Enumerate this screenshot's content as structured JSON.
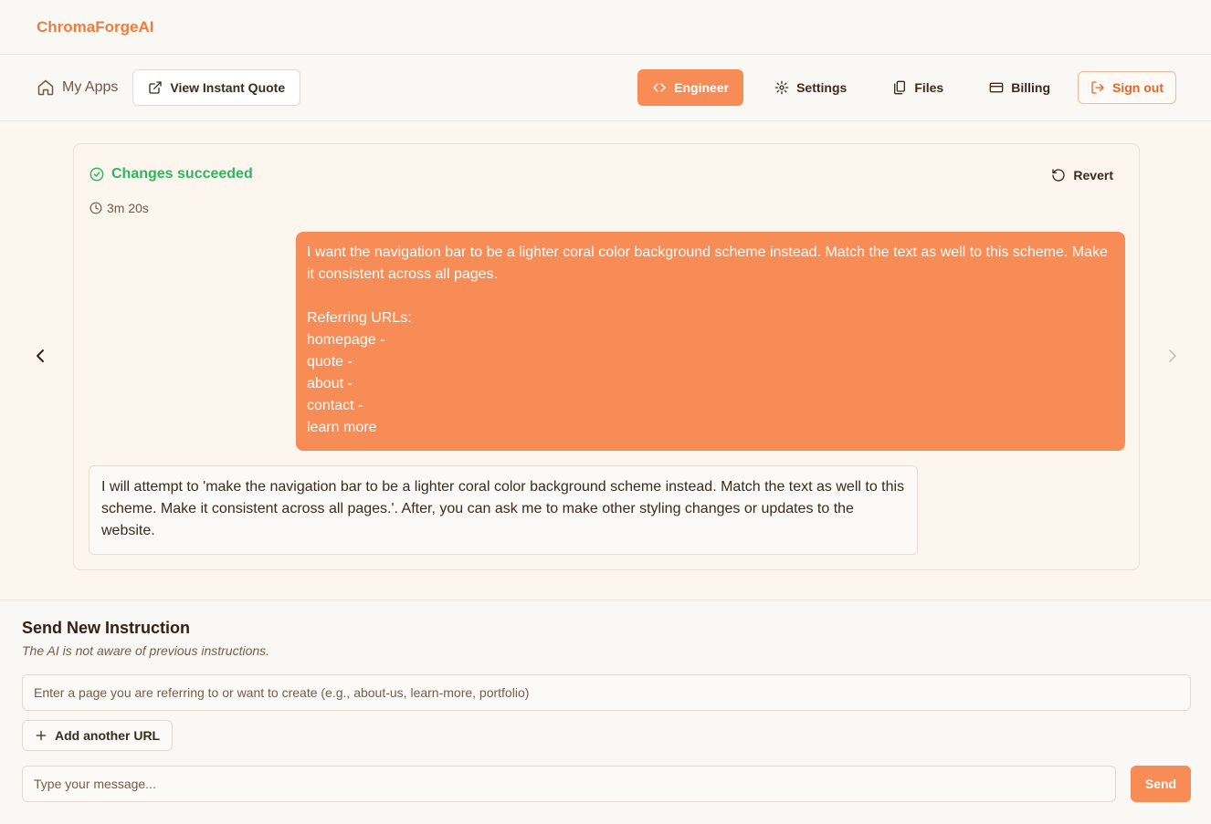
{
  "brand": "ChromaForgeAI",
  "nav": {
    "my_apps": "My Apps",
    "instant_quote": "View Instant Quote",
    "engineer": "Engineer",
    "settings": "Settings",
    "files": "Files",
    "billing": "Billing",
    "sign_out": "Sign out"
  },
  "instruction": {
    "status": "Changes succeeded",
    "status_color": "#2fb55d",
    "duration": "3m 20s",
    "revert": "Revert",
    "user_message": "I want the navigation bar to be a lighter coral color background scheme instead. Match the text as well to this scheme. Make it consistent across all pages.\n\nReferring URLs:\nhomepage -\nquote -\nabout -\ncontact -\nlearn more",
    "ai_message": "I will attempt to 'make the navigation bar to be a lighter coral color background scheme instead. Match the text as well to this scheme. Make it consistent across all pages.'. After, you can ask me to make other styling changes or updates to the website."
  },
  "composer": {
    "title": "Send New Instruction",
    "subtitle": "The AI is not aware of previous instructions.",
    "url_placeholder": "Enter a page you are referring to or want to create (e.g., about-us, learn-more, portfolio)",
    "add_url": "Add another URL",
    "message_placeholder": "Type your message...",
    "send": "Send"
  },
  "colors": {
    "accent": "#f78c57",
    "brand": "#ef7d3c",
    "success": "#2fb55d"
  }
}
